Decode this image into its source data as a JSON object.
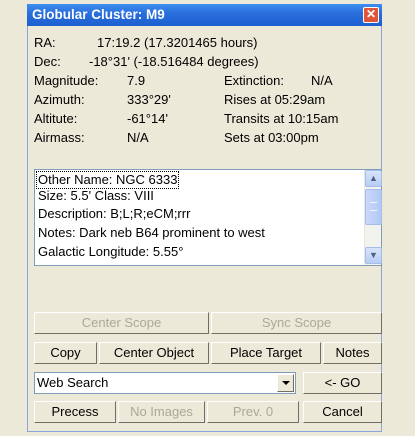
{
  "window": {
    "title": "Globular Cluster: M9",
    "close_glyph": "✕"
  },
  "info": {
    "ra_label": "RA:",
    "ra_value": "17:19.2 (17.3201465 hours)",
    "dec_label": "Dec:",
    "dec_value": "-18°31' (-18.516484 degrees)",
    "magnitude_label": "Magnitude:",
    "magnitude_value": "7.9",
    "extinction_label": "Extinction:",
    "extinction_value": "N/A",
    "azimuth_label": "Azimuth:",
    "azimuth_value": "333°29'",
    "rises": "Rises at 05:29am",
    "altitude_label": "Altitute:",
    "altitude_value": "-61°14'",
    "transits": "Transits at 10:15am",
    "airmass_label": "Airmass:",
    "airmass_value": "N/A",
    "sets": "Sets at 03:00pm"
  },
  "details": {
    "lines": [
      "Other Name: NGC 6333",
      "Size: 5.5'    Class: VIII",
      "Description: B;L;R;eCM;rrr",
      "Notes: Dark neb B64 prominent to west",
      "Galactic Longitude: 5.55°"
    ]
  },
  "buttons": {
    "center_scope": "Center Scope",
    "sync_scope": "Sync Scope",
    "copy": "Copy",
    "center_object": "Center Object",
    "place_target": "Place Target",
    "notes": "Notes",
    "go": "<- GO",
    "precess": "Precess",
    "no_images": "No Images",
    "prev": "Prev. 0",
    "cancel": "Cancel"
  },
  "search": {
    "selected": "Web Search"
  },
  "icons": {
    "scroll_up": "up-arrow",
    "scroll_down": "down-arrow",
    "dropdown": "chevron-down"
  }
}
